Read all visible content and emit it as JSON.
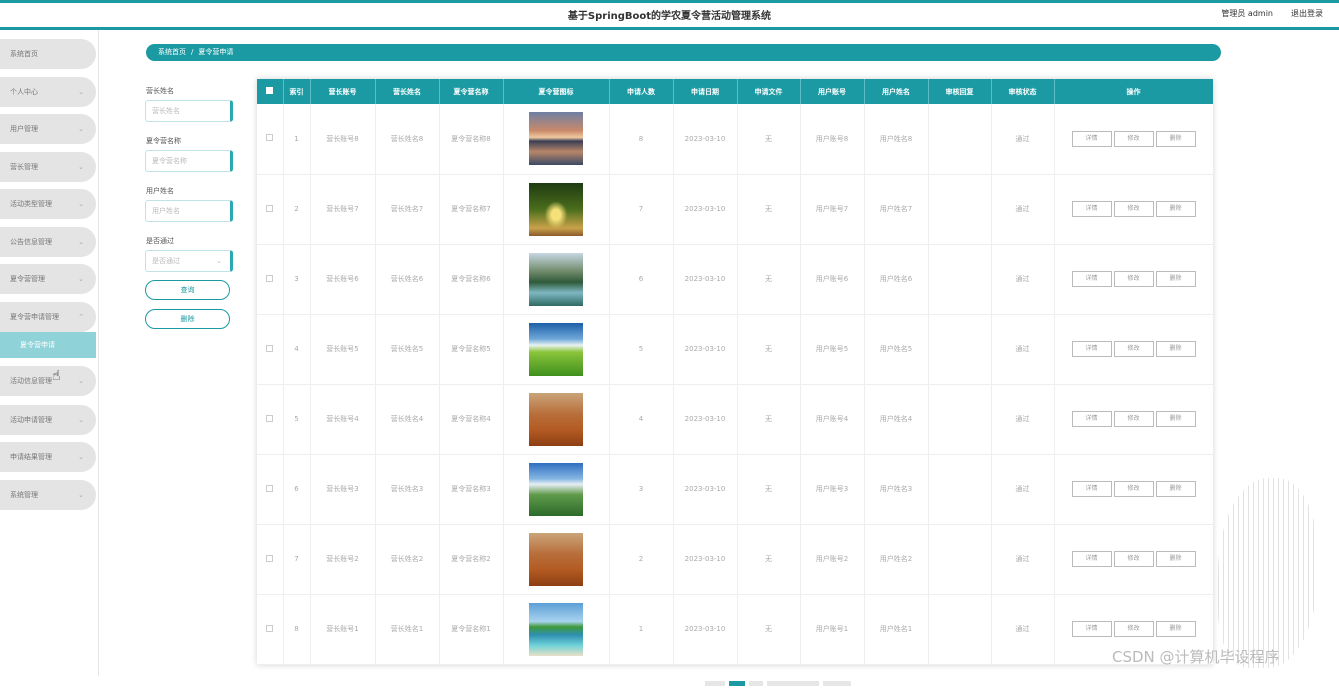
{
  "header": {
    "title": "基于SpringBoot的学农夏令营活动管理系统",
    "user": "管理员 admin",
    "logout": "退出登录"
  },
  "sidebar": {
    "items": [
      {
        "label": "系统首页",
        "chevron": false
      },
      {
        "label": "个人中心",
        "chevron": true
      },
      {
        "label": "用户管理",
        "chevron": true
      },
      {
        "label": "营长管理",
        "chevron": true
      },
      {
        "label": "活动类型管理",
        "chevron": true
      },
      {
        "label": "公告信息管理",
        "chevron": true
      },
      {
        "label": "夏令营管理",
        "chevron": true
      },
      {
        "label": "夏令营申请管理",
        "chevron": true,
        "expanded": true
      },
      {
        "label": "活动信息管理",
        "chevron": true
      },
      {
        "label": "活动申请管理",
        "chevron": true
      },
      {
        "label": "申请结果管理",
        "chevron": true
      },
      {
        "label": "系统管理",
        "chevron": true
      }
    ],
    "active_sub": "夏令营申请"
  },
  "breadcrumb": {
    "home": "系统首页",
    "separator": "/",
    "current": "夏令营申请"
  },
  "search": {
    "leader_name_label": "营长姓名",
    "leader_name_placeholder": "营长姓名",
    "camp_name_label": "夏令营名称",
    "camp_name_placeholder": "夏令营名称",
    "user_name_label": "用户姓名",
    "user_name_placeholder": "用户姓名",
    "passed_label": "是否通过",
    "passed_placeholder": "是否通过",
    "query_button": "查询",
    "delete_button": "删除"
  },
  "table": {
    "headers": [
      "索引",
      "营长账号",
      "营长姓名",
      "夏令营名称",
      "夏令营图标",
      "申请人数",
      "申请日期",
      "申请文件",
      "用户账号",
      "用户姓名",
      "审核回复",
      "审核状态",
      "操作"
    ],
    "actions": [
      "详情",
      "修改",
      "删除"
    ],
    "rows": [
      {
        "index": "1",
        "leader_account": "营长账号8",
        "leader_name": "营长姓名8",
        "camp_name": "夏令营名称8",
        "image": "sunset-lake",
        "count": "8",
        "date": "2023-03-10",
        "file": "无",
        "user_account": "用户账号8",
        "user_name": "用户姓名8",
        "reply": "",
        "status": "通过"
      },
      {
        "index": "2",
        "leader_account": "营长账号7",
        "leader_name": "营长姓名7",
        "camp_name": "夏令营名称7",
        "image": "tree-avenue",
        "count": "7",
        "date": "2023-03-10",
        "file": "无",
        "user_account": "用户账号7",
        "user_name": "用户姓名7",
        "reply": "",
        "status": "通过"
      },
      {
        "index": "3",
        "leader_account": "营长账号6",
        "leader_name": "营长姓名6",
        "camp_name": "夏令营名称6",
        "image": "river-forest",
        "count": "6",
        "date": "2023-03-10",
        "file": "无",
        "user_account": "用户账号6",
        "user_name": "用户姓名6",
        "reply": "",
        "status": "通过"
      },
      {
        "index": "4",
        "leader_account": "营长账号5",
        "leader_name": "营长姓名5",
        "camp_name": "夏令营名称5",
        "image": "green-field",
        "count": "5",
        "date": "2023-03-10",
        "file": "无",
        "user_account": "用户账号5",
        "user_name": "用户姓名5",
        "reply": "",
        "status": "通过"
      },
      {
        "index": "5",
        "leader_account": "营长账号4",
        "leader_name": "营长姓名4",
        "camp_name": "夏令营名称4",
        "image": "desert-tree",
        "count": "4",
        "date": "2023-03-10",
        "file": "无",
        "user_account": "用户账号4",
        "user_name": "用户姓名4",
        "reply": "",
        "status": "通过"
      },
      {
        "index": "6",
        "leader_account": "营长账号3",
        "leader_name": "营长姓名3",
        "camp_name": "夏令营名称3",
        "image": "mountain-valley",
        "count": "3",
        "date": "2023-03-10",
        "file": "无",
        "user_account": "用户账号3",
        "user_name": "用户姓名3",
        "reply": "",
        "status": "通过"
      },
      {
        "index": "7",
        "leader_account": "营长账号2",
        "leader_name": "营长姓名2",
        "camp_name": "夏令营名称2",
        "image": "desert-tree",
        "count": "2",
        "date": "2023-03-10",
        "file": "无",
        "user_account": "用户账号2",
        "user_name": "用户姓名2",
        "reply": "",
        "status": "通过"
      },
      {
        "index": "8",
        "leader_account": "营长账号1",
        "leader_name": "营长姓名1",
        "camp_name": "夏令营名称1",
        "image": "tropical-beach",
        "count": "1",
        "date": "2023-03-10",
        "file": "无",
        "user_account": "用户账号1",
        "user_name": "用户姓名1",
        "reply": "",
        "status": "通过"
      }
    ]
  },
  "watermark": "CSDN @计算机毕设程序",
  "colors": {
    "accent": "#1b9aa3",
    "sub_active": "#8fd3d8",
    "menu_bg": "#e4e4e4"
  }
}
